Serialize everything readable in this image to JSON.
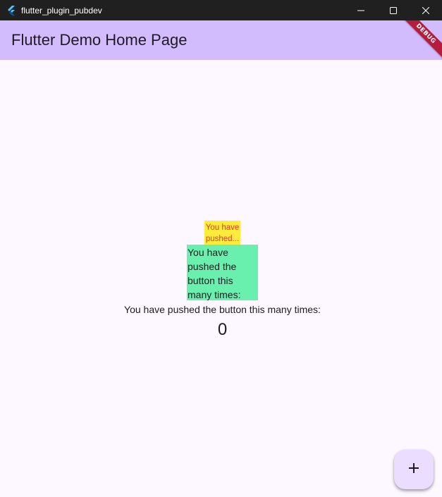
{
  "window": {
    "title": "flutter_plugin_pubdev",
    "controls": {
      "minimize_icon": "minimize-icon",
      "maximize_icon": "maximize-icon",
      "close_icon": "close-icon"
    }
  },
  "appbar": {
    "title": "Flutter Demo Home Page",
    "color": "#d3bcfd"
  },
  "debug_banner": {
    "label": "DEBUG",
    "color": "#b71c3c"
  },
  "main": {
    "yellow_box": {
      "lines": [
        "You have",
        "pushed..."
      ],
      "background": "#ffeb3b",
      "text_color": "#e53935"
    },
    "green_box": {
      "lines": [
        "You have",
        "pushed the",
        "button this",
        "many times:"
      ],
      "background": "#69f0ae"
    },
    "counter_label": "You have pushed the button this many times:",
    "counter_value": "0"
  },
  "fab": {
    "icon": "plus-icon",
    "background": "#eaddff"
  }
}
